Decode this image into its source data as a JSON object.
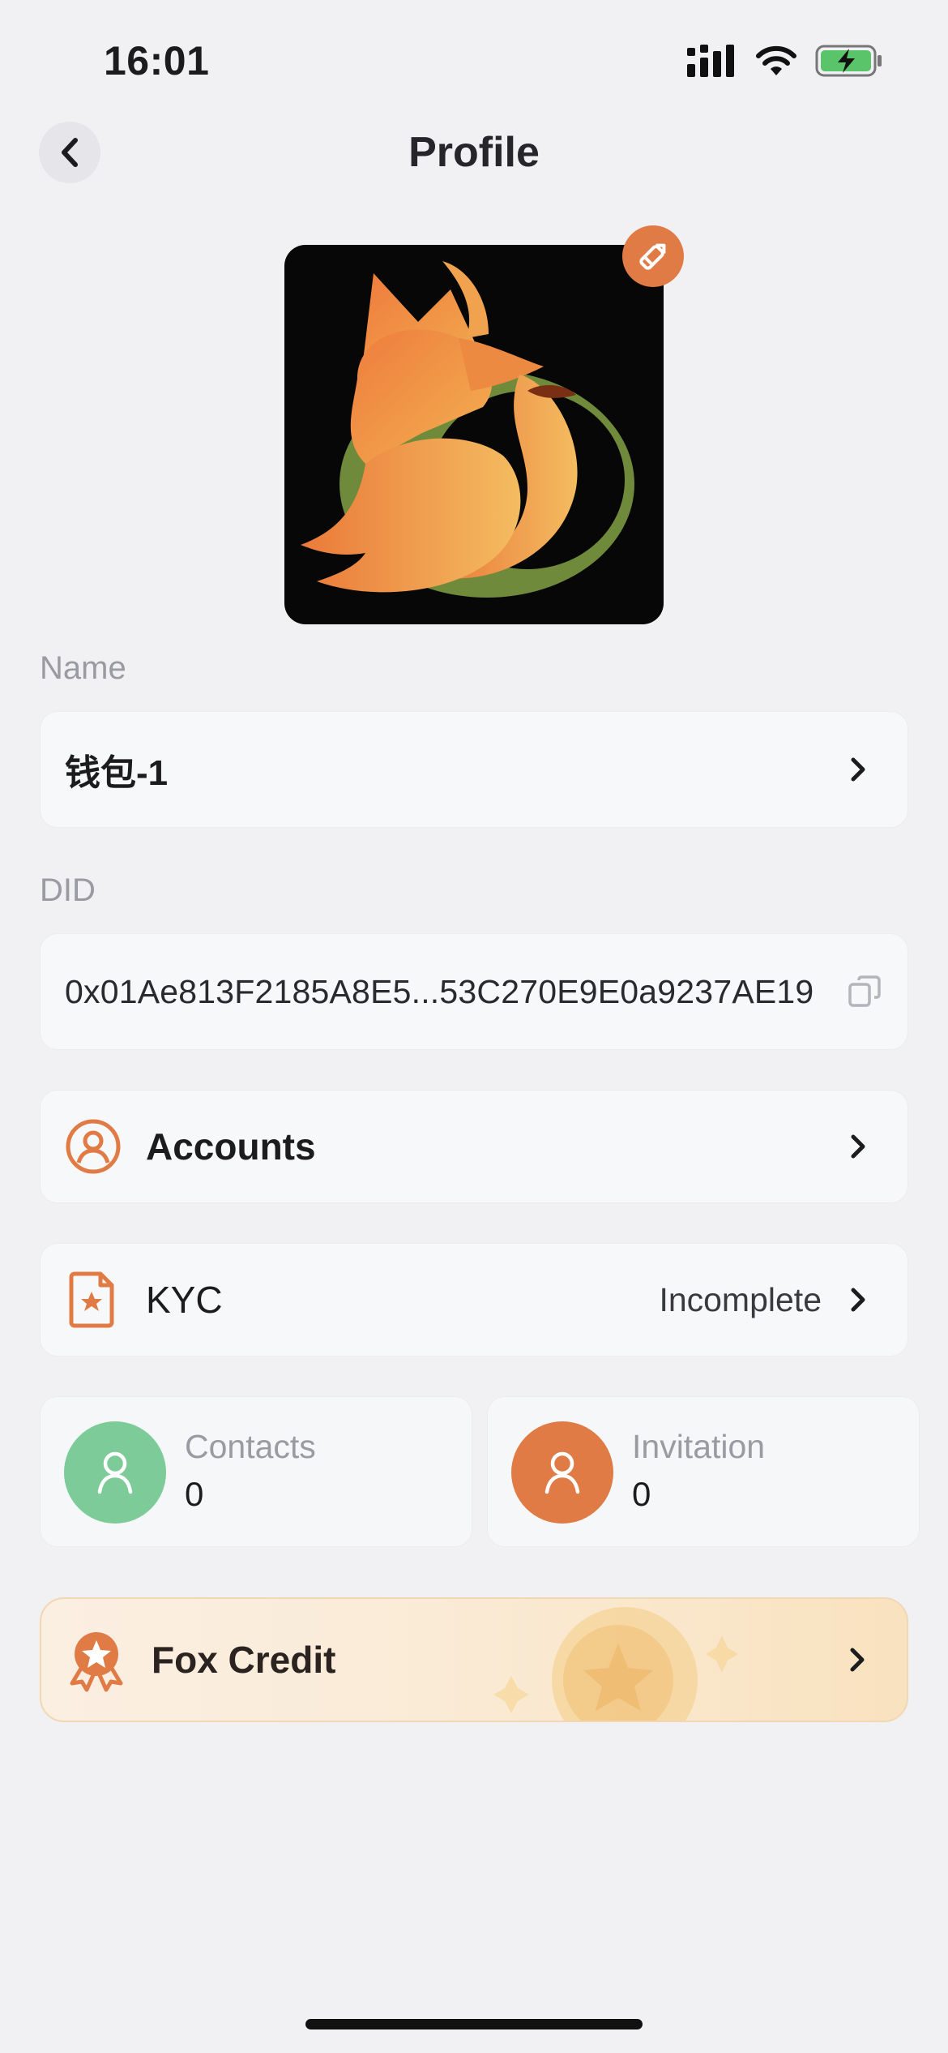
{
  "status_bar": {
    "time": "16:01"
  },
  "header": {
    "title": "Profile"
  },
  "name_section": {
    "label": "Name",
    "value": "钱包-1"
  },
  "did_section": {
    "label": "DID",
    "value": "0x01Ae813F2185A8E5...53C270E9E0a9237AE19"
  },
  "menu": {
    "accounts_label": "Accounts",
    "kyc_label": "KYC",
    "kyc_status": "Incomplete"
  },
  "stats": {
    "contacts": {
      "label": "Contacts",
      "value": "0"
    },
    "invitation": {
      "label": "Invitation",
      "value": "0"
    }
  },
  "credit": {
    "label": "Fox Credit"
  },
  "colors": {
    "accent": "#e07b45",
    "contacts_circle": "#7ccb98",
    "invitation_circle": "#e07b45",
    "background": "#f1f1f3",
    "card": "#f7f8fa"
  },
  "icons": {
    "back": "chevron-left-icon",
    "edit": "pencil-icon",
    "copy": "copy-icon",
    "accounts": "user-circle-icon",
    "kyc": "document-star-icon",
    "credit": "medal-icon"
  }
}
